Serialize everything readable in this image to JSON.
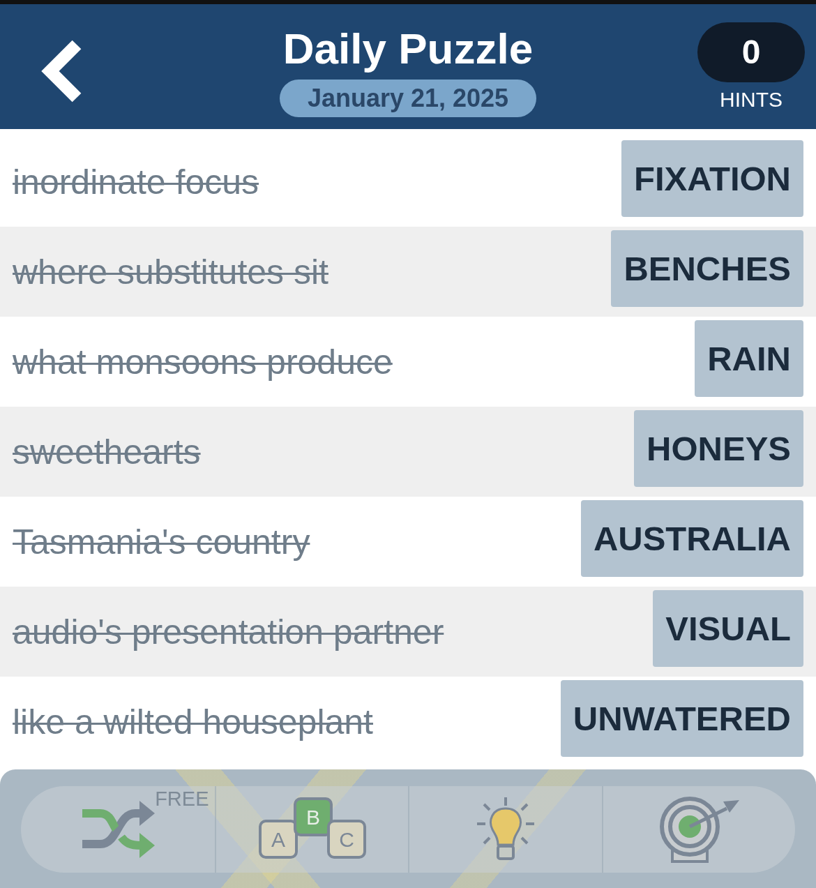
{
  "header": {
    "title": "Daily Puzzle",
    "date": "January 21, 2025",
    "hints_count": "0",
    "hints_label": "HINTS"
  },
  "clues": [
    {
      "clue": "inordinate focus",
      "answer": "FIXATION",
      "solved": true
    },
    {
      "clue": "where substitutes sit",
      "answer": "BENCHES",
      "solved": true
    },
    {
      "clue": "what monsoons produce",
      "answer": "RAIN",
      "solved": true
    },
    {
      "clue": "sweethearts",
      "answer": "HONEYS",
      "solved": true
    },
    {
      "clue": "Tasmania's country",
      "answer": "AUSTRALIA",
      "solved": true
    },
    {
      "clue": "audio's presentation partner",
      "answer": "VISUAL",
      "solved": true
    },
    {
      "clue": "like a wilted houseplant",
      "answer": "UNWATERED",
      "solved": true
    }
  ],
  "toolbar": [
    {
      "kind": "shuffle",
      "badge": "FREE"
    },
    {
      "kind": "letters",
      "letters": [
        "A",
        "B",
        "C"
      ]
    },
    {
      "kind": "hint"
    },
    {
      "kind": "target"
    }
  ]
}
